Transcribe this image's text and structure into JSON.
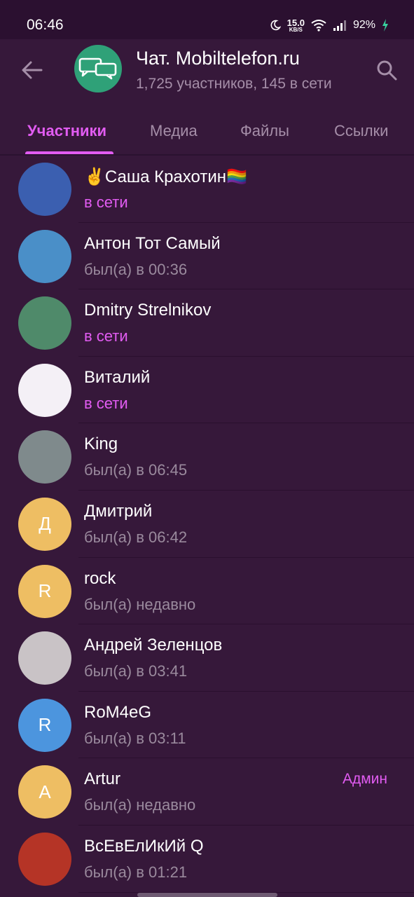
{
  "status_bar": {
    "time": "06:46",
    "net_speed_value": "15.0",
    "net_speed_unit": "KB/S",
    "battery": "92%",
    "icons": [
      "moon-icon",
      "wifi-icon",
      "signal-icon",
      "charging-icon"
    ]
  },
  "header": {
    "title": "Чат. Mobiltelefon.ru",
    "subtitle": "1,725 участников, 145 в сети",
    "back_icon": "arrow-left-icon",
    "search_icon": "search-icon",
    "avatar_icon": "chat-bubbles-icon",
    "avatar_color": "#2fa178"
  },
  "tabs": [
    {
      "label": "Участники",
      "active": true
    },
    {
      "label": "Медиа",
      "active": false
    },
    {
      "label": "Файлы",
      "active": false
    },
    {
      "label": "Ссылки",
      "active": false
    }
  ],
  "colors": {
    "background": "#36183a",
    "accent": "#e25cf2",
    "muted_text": "#9a8a9d"
  },
  "members": [
    {
      "name": "✌️Саша Крахотин🏳️‍🌈",
      "status": "в сети",
      "online": true,
      "avatar_letter": "",
      "avatar_color": "#3b5fb0",
      "role": ""
    },
    {
      "name": "Антон Тот Самый",
      "status": "был(а) в 00:36",
      "online": false,
      "avatar_letter": "",
      "avatar_color": "#4a8fc8",
      "role": ""
    },
    {
      "name": "Dmitry Strelnikov",
      "status": "в сети",
      "online": true,
      "avatar_letter": "",
      "avatar_color": "#4f8a6a",
      "role": ""
    },
    {
      "name": "Виталий",
      "status": "в сети",
      "online": true,
      "avatar_letter": "",
      "avatar_color": "#f4f0f6",
      "role": ""
    },
    {
      "name": "King",
      "status": "был(а) в 06:45",
      "online": false,
      "avatar_letter": "",
      "avatar_color": "#7f8a8c",
      "role": ""
    },
    {
      "name": "Дмитрий",
      "status": "был(а) в 06:42",
      "online": false,
      "avatar_letter": "Д",
      "avatar_color": "#eebe63",
      "role": ""
    },
    {
      "name": "rock",
      "status": "был(а) недавно",
      "online": false,
      "avatar_letter": "R",
      "avatar_color": "#eebe63",
      "role": ""
    },
    {
      "name": "Андрей Зеленцов",
      "status": "был(а) в 03:41",
      "online": false,
      "avatar_letter": "",
      "avatar_color": "#c9c3c6",
      "role": ""
    },
    {
      "name": "RoM4eG",
      "status": "был(а) в 03:11",
      "online": false,
      "avatar_letter": "R",
      "avatar_color": "#4c95de",
      "role": ""
    },
    {
      "name": "Artur",
      "status": "был(а) недавно",
      "online": false,
      "avatar_letter": "A",
      "avatar_color": "#eebe63",
      "role": "Админ"
    },
    {
      "name": "ВсЕвЕлИкИй Q",
      "status": "был(а) в 01:21",
      "online": false,
      "avatar_letter": "",
      "avatar_color": "#b53426",
      "role": ""
    }
  ]
}
